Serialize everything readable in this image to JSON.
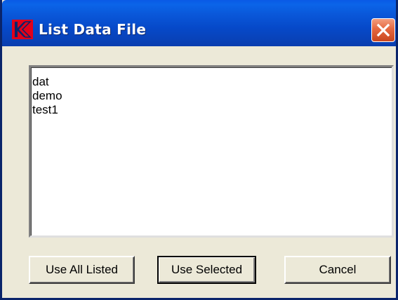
{
  "window": {
    "title": "List Data File",
    "close_icon": "close-icon",
    "app_icon": "app-logo-icon",
    "colors": {
      "titlebar": "#0A58DA",
      "close_button": "#E5673F",
      "face": "#ECE9D8",
      "icon_red": "#E1001A"
    }
  },
  "list": {
    "items": [
      "dat",
      "demo",
      "test1"
    ]
  },
  "buttons": {
    "use_all_listed": "Use All Listed",
    "use_selected": "Use Selected",
    "cancel": "Cancel"
  }
}
